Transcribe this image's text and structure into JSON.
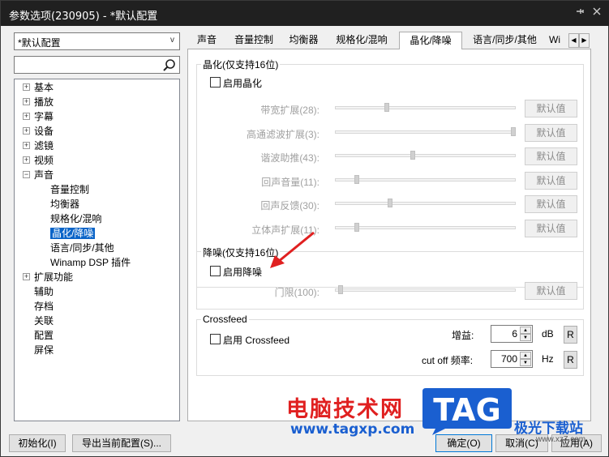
{
  "window": {
    "title": "参数选项(230905) - *默认配置",
    "pin_icon": "pin-icon",
    "close_icon": "close-icon"
  },
  "left": {
    "profile": "*默认配置",
    "profile_arrow": "v",
    "search_placeholder": "",
    "tree": [
      {
        "label": "基本",
        "level": 0,
        "expander": "+"
      },
      {
        "label": "播放",
        "level": 0,
        "expander": "+"
      },
      {
        "label": "字幕",
        "level": 0,
        "expander": "+"
      },
      {
        "label": "设备",
        "level": 0,
        "expander": "+"
      },
      {
        "label": "滤镜",
        "level": 0,
        "expander": "+"
      },
      {
        "label": "视频",
        "level": 0,
        "expander": "+"
      },
      {
        "label": "声音",
        "level": 0,
        "expander": "−"
      },
      {
        "label": "音量控制",
        "level": 1
      },
      {
        "label": "均衡器",
        "level": 1
      },
      {
        "label": "规格化/混响",
        "level": 1
      },
      {
        "label": "晶化/降噪",
        "level": 1,
        "selected": true
      },
      {
        "label": "语言/同步/其他",
        "level": 1
      },
      {
        "label": "Winamp DSP 插件",
        "level": 1
      },
      {
        "label": "扩展功能",
        "level": 0,
        "expander": "+"
      },
      {
        "label": "辅助",
        "level": 0
      },
      {
        "label": "存档",
        "level": 0
      },
      {
        "label": "关联",
        "level": 0
      },
      {
        "label": "配置",
        "level": 0
      },
      {
        "label": "屏保",
        "level": 0
      }
    ]
  },
  "tabs": [
    "声音",
    "音量控制",
    "均衡器",
    "规格化/混响",
    "晶化/降噪",
    "语言/同步/其他",
    "Wi"
  ],
  "tab_scroll": {
    "left": "◀",
    "right": "▶"
  },
  "crystal": {
    "title": "晶化(仅支持16位)",
    "enable_label": "启用晶化",
    "params": [
      {
        "label": "带宽扩展(28):",
        "value": 0.28
      },
      {
        "label": "高通滤波扩展(3):",
        "value": 1.0
      },
      {
        "label": "谐波助推(43):",
        "value": 0.43
      },
      {
        "label": "回声音量(11):",
        "value": 0.11
      },
      {
        "label": "回声反馈(30):",
        "value": 0.3
      },
      {
        "label": "立体声扩展(11):",
        "value": 0.11
      }
    ],
    "default_label": "默认值"
  },
  "denoise": {
    "title": "降噪(仅支持16位)",
    "enable_label": "启用降噪",
    "threshold_label": "门限(100):",
    "threshold_value": 0.0,
    "default_label": "默认值"
  },
  "crossfeed": {
    "title": "Crossfeed",
    "enable_label": "启用 Crossfeed",
    "gain_label": "增益:",
    "gain_value": "6",
    "gain_unit": "dB",
    "cutoff_label": "cut off 频率:",
    "cutoff_value": "700",
    "cutoff_unit": "Hz",
    "reset_label": "R"
  },
  "bottom": {
    "init": "初始化(I)",
    "export": "导出当前配置(S)...",
    "ok": "确定(O)",
    "cancel": "取消(C)",
    "apply": "应用(A)"
  },
  "watermark": {
    "brand": "电脑技术网",
    "url": "www.tagxp.com",
    "logo": "TAG",
    "site": "极光下载站",
    "site_url": "www.xz7.com"
  },
  "colors": {
    "selection": "#0a64c8",
    "annotation_arrow": "#e02020"
  }
}
